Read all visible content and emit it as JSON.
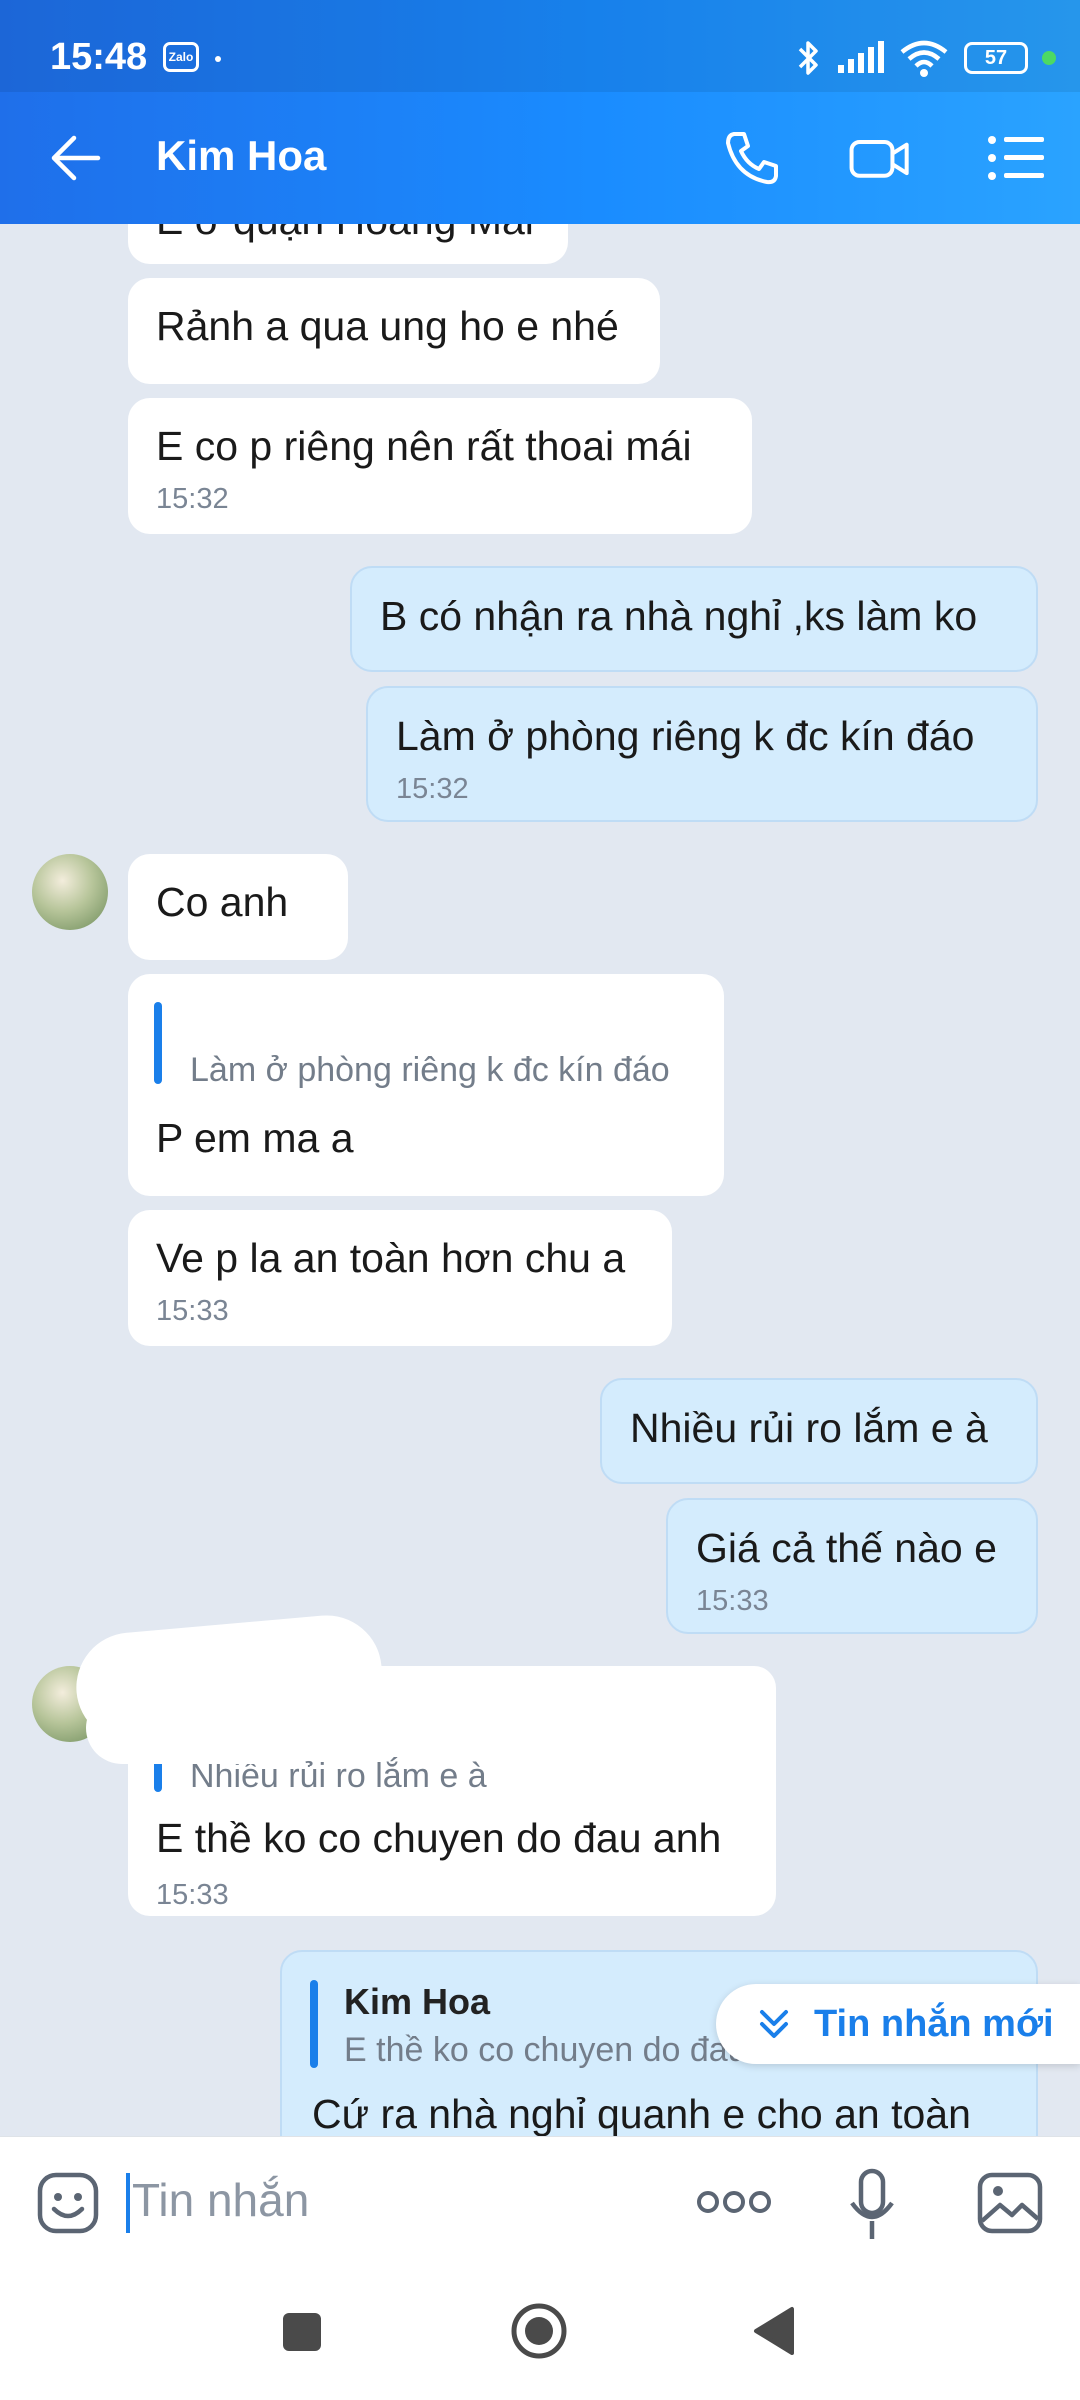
{
  "status": {
    "time": "15:48",
    "app_badge": "Zalo",
    "battery": "57"
  },
  "header": {
    "title": "Kim Hoa"
  },
  "messages": {
    "m0_partial": "E ở quận Hoàng Mai",
    "m1": "Rảnh a qua ung ho e nhé",
    "m2": "E co p riêng nên rất thoai mái",
    "m2_time": "15:32",
    "m3": "B có nhận ra nhà nghỉ ,ks làm ko",
    "m4": "Làm ở phòng riêng k đc kín đáo",
    "m4_time": "15:32",
    "m5": "Co anh",
    "m6_quote": "Làm ở phòng riêng k đc kín đáo",
    "m6": "P em ma a",
    "m7": "Ve p la an toàn hơn chu a",
    "m7_time": "15:33",
    "m8": "Nhiều rủi ro lắm e à",
    "m9": "Giá cả thế nào e",
    "m9_time": "15:33",
    "m10_quote": "Nhiều rủi ro lắm e à",
    "m10": "E thề ko co chuyen do đau anh",
    "m10_time": "15:33",
    "m11_quote_author": "Kim Hoa",
    "m11_quote": "E thề ko co chuyen do đau anh",
    "m11": "Cứ ra nhà nghỉ quanh e cho an toàn"
  },
  "new_messages_label": "Tin nhắn mới",
  "input": {
    "placeholder": "Tin nhắn"
  },
  "colors": {
    "accent": "#1a7fea",
    "header_start": "#1f6fea",
    "outgoing_bubble": "#d4ecfd"
  }
}
